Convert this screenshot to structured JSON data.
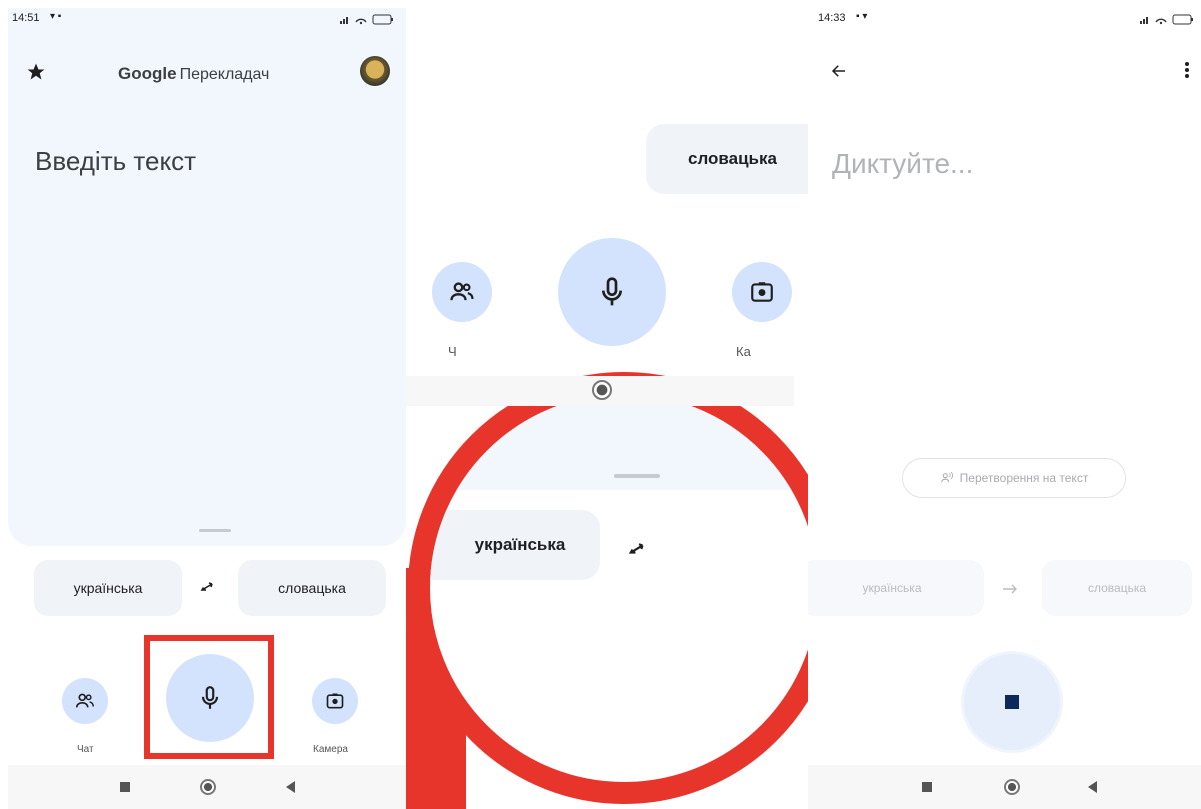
{
  "panel1": {
    "status_time": "14:51",
    "status_right": "⁂ ◠ ▭",
    "app_title_brand": "Google",
    "app_title_product": "Перекладач",
    "input_placeholder": "Введіть текст",
    "source_lang": "українська",
    "target_lang": "словацька",
    "chat_label": "Чат",
    "camera_label": "Камера"
  },
  "panel2": {
    "source_lang": "українська",
    "target_lang": "словацька",
    "chat_label_partial": "Ч",
    "camera_label_partial": "Ка"
  },
  "panel3": {
    "status_time": "14:33",
    "dictate_text": "Диктуйте...",
    "transcribe_chip": "Перетворення на текст",
    "source_lang": "українська",
    "target_lang": "словацька"
  },
  "colors": {
    "accent_blue": "#d3e3fd",
    "mic_blue": "#0b57d0",
    "highlight_red": "#e8352c",
    "card_bg": "#f2f6fd"
  }
}
